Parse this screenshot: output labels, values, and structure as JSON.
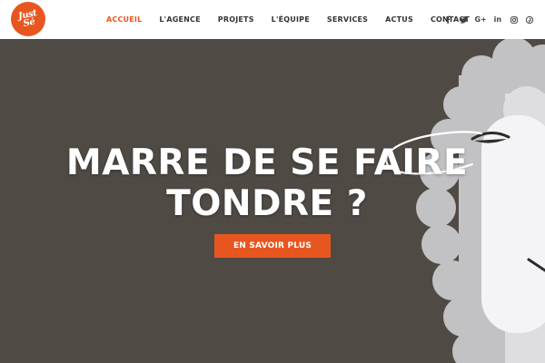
{
  "brand": {
    "logo_alt_text": "Just Sé",
    "color": "#e8561f"
  },
  "nav": {
    "items": [
      {
        "label": "ACCUEIL",
        "active": true
      },
      {
        "label": "L'AGENCE",
        "active": false
      },
      {
        "label": "PROJETS",
        "active": false
      },
      {
        "label": "L'ÉQUIPE",
        "active": false
      },
      {
        "label": "SERVICES",
        "active": false
      },
      {
        "label": "ACTUS",
        "active": false
      },
      {
        "label": "CONTACT",
        "active": false
      }
    ],
    "active_color": "#e8561f"
  },
  "social": [
    {
      "icon": "facebook-icon"
    },
    {
      "icon": "twitter-icon"
    },
    {
      "icon": "google-plus-icon"
    },
    {
      "icon": "linkedin-icon"
    },
    {
      "icon": "instagram-icon"
    },
    {
      "icon": "pinterest-icon"
    }
  ],
  "hero": {
    "title_line1": "MARRE DE SE FAIRE",
    "title_line2": "TONDRE ?",
    "cta_label": "EN SAVOIR PLUS",
    "background_color": "#504a45",
    "illustration": "sheep"
  }
}
